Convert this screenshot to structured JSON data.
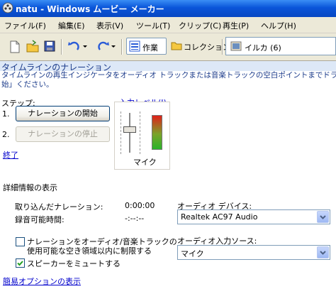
{
  "window": {
    "title": "natu - Windows ムービー メーカー"
  },
  "menu": [
    "ファイル(F)",
    "編集(E)",
    "表示(V)",
    "ツール(T)",
    "クリップ(C)",
    "再生(P)",
    "ヘルプ(H)"
  ],
  "toolbar": {
    "tasks_label": "作業",
    "collections_label": "コレクション",
    "collection_selected": "イルカ (6)"
  },
  "panel": {
    "title": "タイムラインのナレーション",
    "description": "タイムラインの再生インジケータをオーディオ トラックまたは音楽トラックの空白ポイントまでドラッグし、[ナレ\n始」ください。",
    "steps_label": "ステップ:",
    "step1_num": "1.",
    "step2_num": "2.",
    "start_button": "ナレーションの開始",
    "stop_button": "ナレーションの停止",
    "finish_link": "終了",
    "input_level_label": "入力レベル(I)",
    "mic_label": "マイク",
    "input_level_fraction": 0.6,
    "meter_fraction": 0.3,
    "details_label": "詳細情報の表示",
    "captured_label": "取り込んだナレーション:",
    "captured_value": "0:00:00",
    "available_label": "録音可能時間:",
    "available_value": "-:--:--",
    "audio_device_label": "オーディオ デバイス:",
    "audio_device_value": "Realtek AC97 Audio",
    "input_source_label": "オーディオ入力ソース:",
    "input_source_value": "マイク",
    "limit_checkbox_line1": "ナレーションをオーディオ/音楽トラックの",
    "limit_checkbox_line2": "使用可能な空き領域以内に制限する",
    "limit_checked": false,
    "mute_checkbox": "スピーカーをミュートする",
    "mute_checked": true,
    "simple_options_link": "簡易オプションの表示"
  },
  "colors": {
    "titlebar": "#0a55d9",
    "link": "#0000cc",
    "panel_text": "#1a3a8a"
  }
}
